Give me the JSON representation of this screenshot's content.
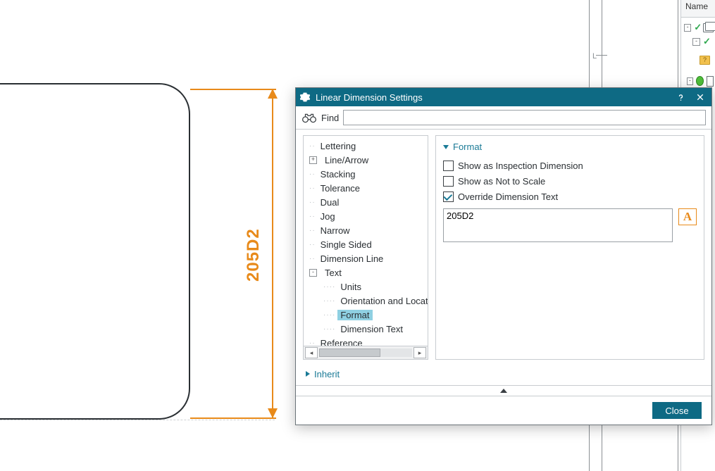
{
  "canvas": {
    "dimension_text": "205D2",
    "ruler_mark": "L"
  },
  "side_panel": {
    "header": "Name"
  },
  "dialog": {
    "title": "Linear Dimension Settings",
    "find_label": "Find",
    "find_value": "",
    "tree": {
      "items": [
        {
          "label": "Lettering",
          "level": 1,
          "exp": ""
        },
        {
          "label": "Line/Arrow",
          "level": 1,
          "exp": "+"
        },
        {
          "label": "Stacking",
          "level": 1,
          "exp": ""
        },
        {
          "label": "Tolerance",
          "level": 1,
          "exp": ""
        },
        {
          "label": "Dual",
          "level": 1,
          "exp": ""
        },
        {
          "label": "Jog",
          "level": 1,
          "exp": ""
        },
        {
          "label": "Narrow",
          "level": 1,
          "exp": ""
        },
        {
          "label": "Single Sided",
          "level": 1,
          "exp": ""
        },
        {
          "label": "Dimension Line",
          "level": 1,
          "exp": ""
        },
        {
          "label": "Text",
          "level": 1,
          "exp": "-"
        },
        {
          "label": "Units",
          "level": 2,
          "exp": ""
        },
        {
          "label": "Orientation and Location",
          "level": 2,
          "exp": ""
        },
        {
          "label": "Format",
          "level": 2,
          "exp": "",
          "selected": true
        },
        {
          "label": "Dimension Text",
          "level": 2,
          "exp": ""
        },
        {
          "label": "Reference",
          "level": 1,
          "exp": ""
        }
      ]
    },
    "content": {
      "section": "Format",
      "checks": [
        {
          "label": "Show as Inspection Dimension",
          "checked": false
        },
        {
          "label": "Show as Not to Scale",
          "checked": false
        },
        {
          "label": "Override Dimension Text",
          "checked": true
        }
      ],
      "override_value": "205D2",
      "symbol_button": "A"
    },
    "inherit_label": "Inherit",
    "close_label": "Close"
  }
}
